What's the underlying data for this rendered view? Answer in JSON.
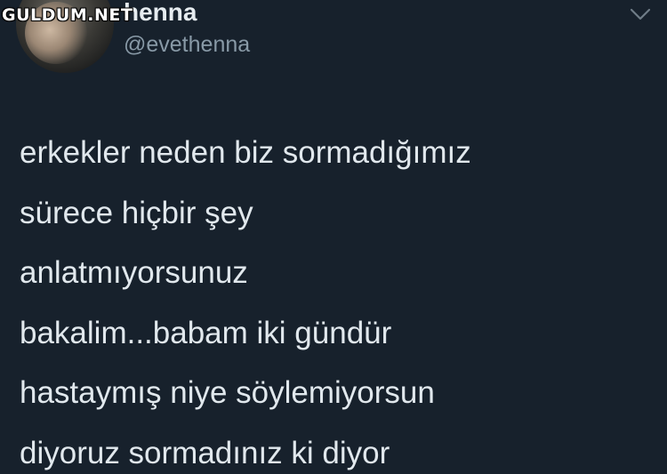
{
  "watermark": "GULDUM.NET",
  "tweet": {
    "display_name": "henna",
    "handle": "@evethenna",
    "menu_icon": "chevron-down-icon",
    "avatar_icon": "profile-photo",
    "lines": [
      "erkekler neden biz sormadığımız",
      "sürece hiçbir şey",
      "anlatmıyorsunuz",
      "bakalim...babam iki gündür",
      "hastaymış niye söylemiyorsun",
      "diyoruz sormadınız ki diyor"
    ]
  },
  "colors": {
    "background": "#17212c",
    "text": "#e1e8ed",
    "secondary_text": "#8899a6"
  }
}
